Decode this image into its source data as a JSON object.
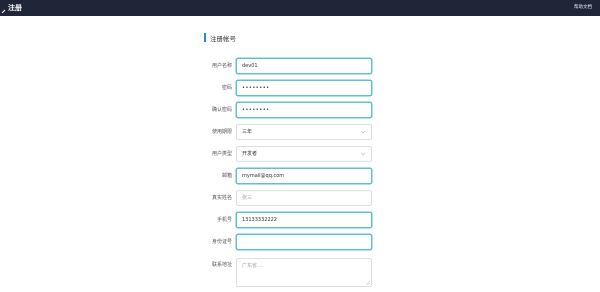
{
  "app": {
    "title": "注册",
    "help_link": "帮助文档"
  },
  "form": {
    "section_title": "注册帐号",
    "fields": [
      {
        "label": "用户名称",
        "value": "dev01",
        "type": "text"
      },
      {
        "label": "密码",
        "value": "••••••••",
        "type": "password"
      },
      {
        "label": "确认密码",
        "value": "••••••••",
        "type": "password"
      },
      {
        "label": "使用期限",
        "value": "三年",
        "type": "select"
      },
      {
        "label": "用户类型",
        "value": "开发者",
        "type": "select"
      },
      {
        "label": "邮箱",
        "value": "mymail@qq.com",
        "type": "text"
      },
      {
        "label": "真实姓名",
        "placeholder": "张三",
        "type": "text"
      },
      {
        "label": "手机号",
        "value": "13133332222",
        "type": "text"
      },
      {
        "label": "身份证号",
        "value": "",
        "type": "text"
      },
      {
        "label": "联系地址",
        "placeholder": "广东省....",
        "type": "textarea"
      }
    ]
  }
}
